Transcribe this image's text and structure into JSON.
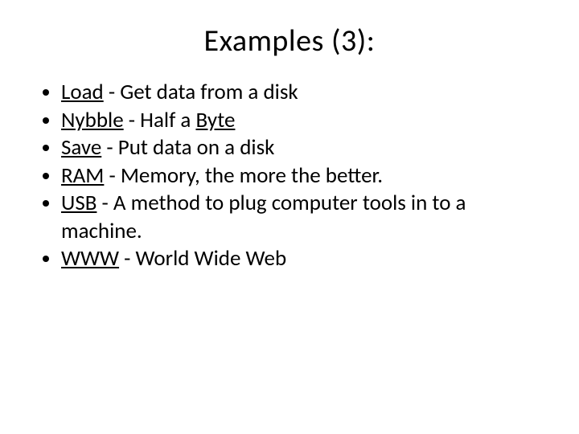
{
  "title": "Examples (3):",
  "items": [
    {
      "term": "Load",
      "rest": " - Get data from a disk",
      "extra_link": null
    },
    {
      "term": "Nybble",
      "rest": " - Half a ",
      "extra_link": "Byte"
    },
    {
      "term": "Save",
      "rest": " - Put data on a disk",
      "extra_link": null
    },
    {
      "term": "RAM",
      "rest": " - Memory, the more the better.",
      "extra_link": null
    },
    {
      "term": "USB",
      "rest": " - A method to plug computer tools in to a machine.",
      "extra_link": null
    },
    {
      "term": "WWW",
      "rest": " - World Wide Web",
      "extra_link": null
    }
  ]
}
